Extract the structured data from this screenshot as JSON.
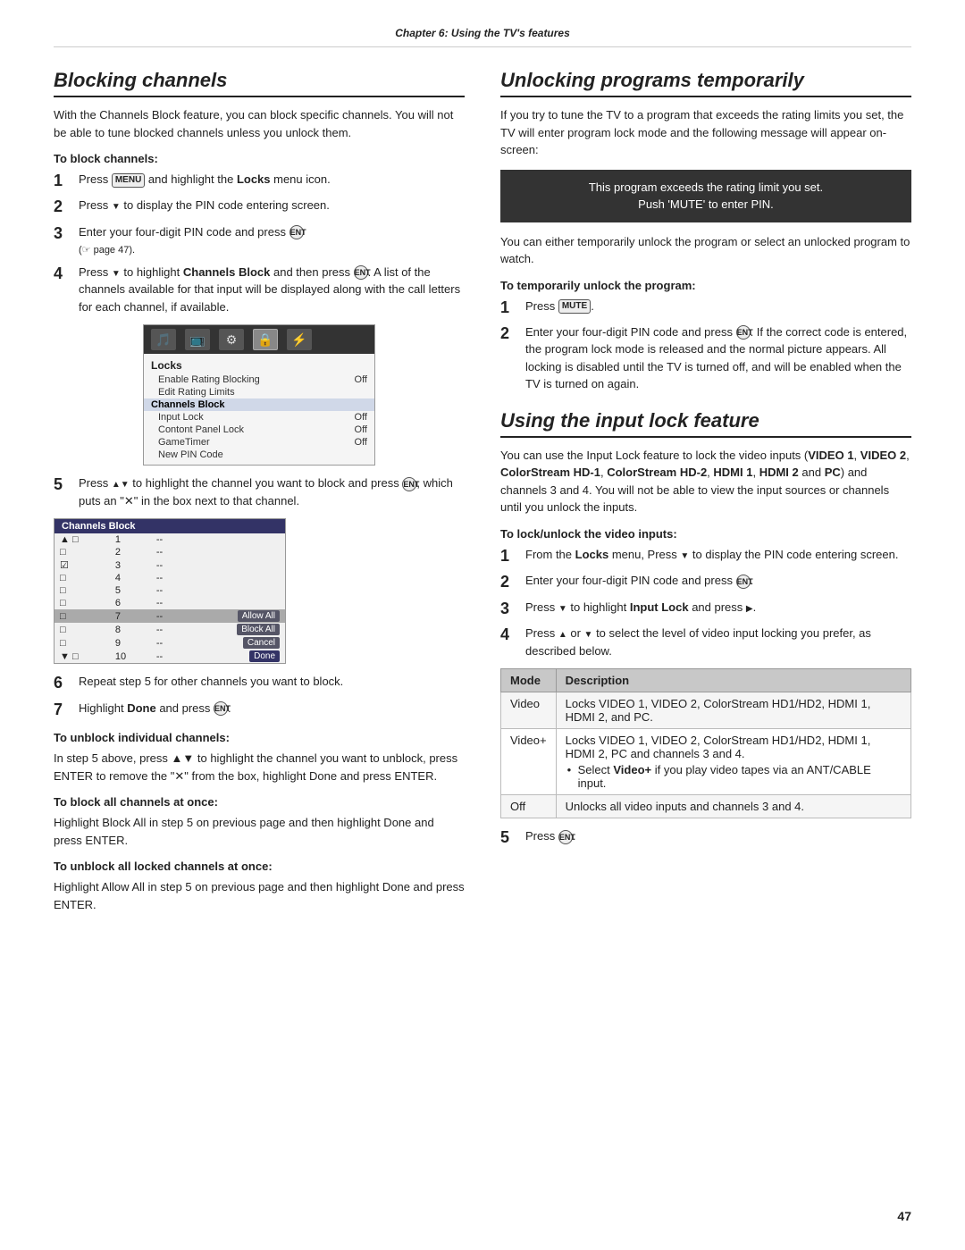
{
  "header": {
    "chapter_title": "Chapter 6: Using the TV's features"
  },
  "left": {
    "heading": "Blocking channels",
    "intro": "With the Channels Block feature, you can block specific channels. You will not be able to tune blocked channels unless you unlock them.",
    "to_block_heading": "To block channels:",
    "to_unblock_individual_heading": "To unblock individual channels:",
    "to_unblock_individual_text": "In step 5 above, press ▲▼ to highlight the channel you want to unblock, press ENTER to remove the \"✕\" from the box, highlight Done and press ENTER.",
    "to_block_all_heading": "To block all channels at once:",
    "to_block_all_text": "Highlight Block All in step 5 on previous page and then highlight Done and press ENTER.",
    "to_unblock_all_heading": "To unblock all locked channels at once:",
    "to_unblock_all_text": "Highlight Allow All in step 5 on previous page and then highlight Done and press ENTER."
  },
  "right": {
    "heading": "Unlocking programs temporarily",
    "intro": "If you try to tune the TV to a program that exceeds the rating limits you set, the TV will enter program lock mode and the following message will appear on-screen:",
    "info_box": {
      "line1": "This program exceeds the rating limit you set.",
      "line2": "Push 'MUTE' to enter PIN."
    },
    "desc": "You can either temporarily unlock the program or select an unlocked program to watch.",
    "to_temp_unlock_heading": "To temporarily unlock the program:",
    "input_lock_heading": "Using the input lock feature",
    "to_lock_unlock_heading": "To lock/unlock the video inputs:",
    "table": {
      "header": {
        "mode": "Mode",
        "description": "Description"
      },
      "rows": [
        {
          "mode": "Video",
          "description": "Locks VIDEO 1, VIDEO 2, ColorStream HD1/HD2, HDMI 1, HDMI 2, and PC."
        },
        {
          "mode": "Video+",
          "description": "Locks VIDEO 1, VIDEO 2, ColorStream HD1/HD2, HDMI 1, HDMI 2, PC and channels 3 and 4."
        },
        {
          "mode": "Off",
          "description": "Unlocks all video inputs and channels 3 and 4."
        }
      ]
    }
  },
  "footer": {
    "page_number": "47"
  }
}
